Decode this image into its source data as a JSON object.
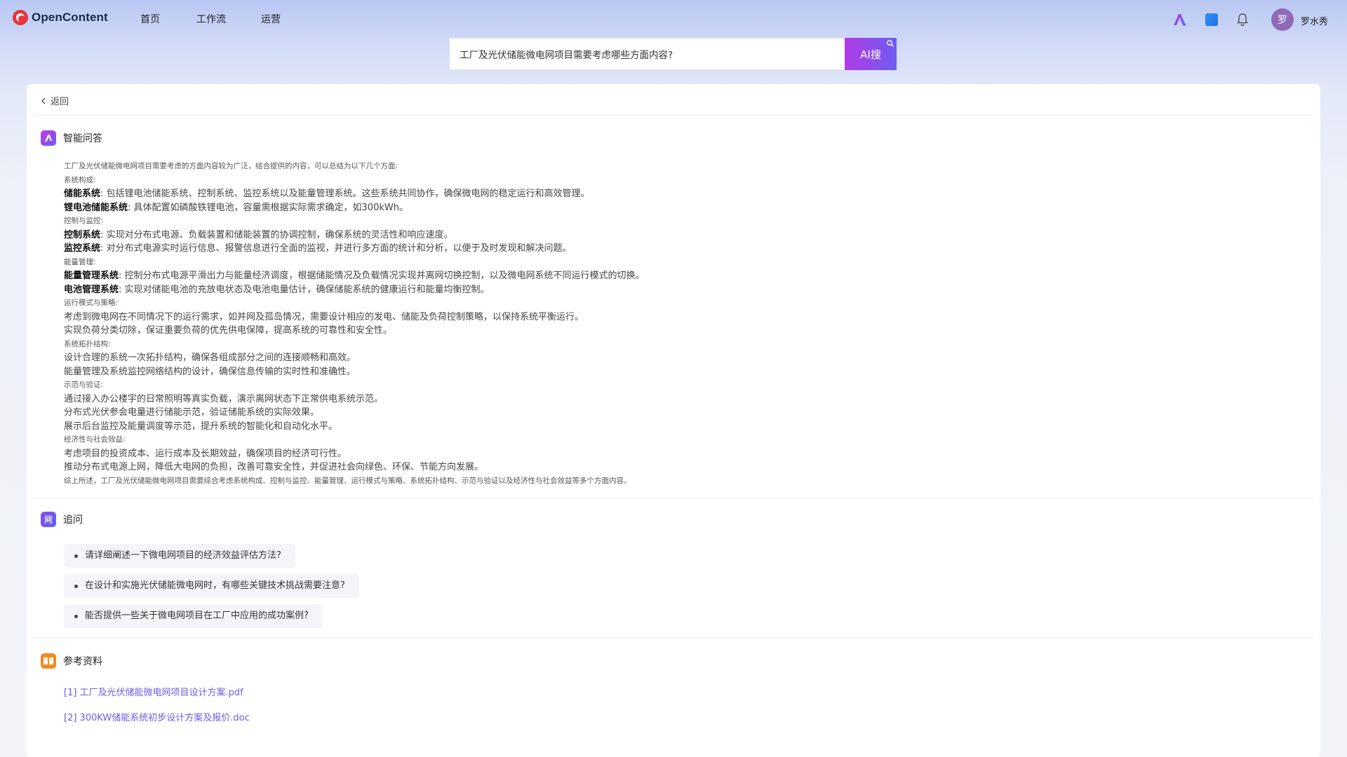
{
  "brand": {
    "name": "OpenContent"
  },
  "nav": {
    "items": [
      "首页",
      "工作流",
      "运营"
    ]
  },
  "user": {
    "avatar_initial": "罗",
    "name": "罗水秀"
  },
  "search": {
    "value": "工厂及光伏储能微电网项目需要考虑哪些方面内容?",
    "button_label": "AI搜"
  },
  "back_label": "返回",
  "answer": {
    "title": "智能问答",
    "lines": [
      {
        "style": "small",
        "text": "工厂及光伏储能微电网项目需要考虑的方面内容较为广泛，结合提供的内容，可以总结为以下几个方面:"
      },
      {
        "style": "small",
        "text": "系统构成:"
      },
      {
        "style": "body",
        "label": "储能系统",
        "text": ": 包括锂电池储能系统、控制系统、监控系统以及能量管理系统。这些系统共同协作，确保微电网的稳定运行和高效管理。"
      },
      {
        "style": "body",
        "label": "锂电池储能系统",
        "text": ": 具体配置如磷酸铁锂电池，容量需根据实际需求确定，如300kWh。"
      },
      {
        "style": "small",
        "text": "控制与监控:"
      },
      {
        "style": "body",
        "label": "控制系统",
        "text": ": 实现对分布式电源、负载装置和储能装置的协调控制，确保系统的灵活性和响应速度。"
      },
      {
        "style": "body",
        "label": "监控系统",
        "text": ": 对分布式电源实时运行信息、报警信息进行全面的监视，并进行多方面的统计和分析，以便于及时发现和解决问题。"
      },
      {
        "style": "small",
        "text": "能量管理:"
      },
      {
        "style": "body",
        "label": "能量管理系统",
        "text": ": 控制分布式电源平滑出力与能量经济调度，根据储能情况及负载情况实现并离网切换控制，以及微电网系统不同运行模式的切换。"
      },
      {
        "style": "body",
        "label": "电池管理系统",
        "text": ": 实现对储能电池的充放电状态及电池电量估计，确保储能系统的健康运行和能量均衡控制。"
      },
      {
        "style": "small",
        "text": "运行模式与策略:"
      },
      {
        "style": "body",
        "label": "",
        "text": "考虑到微电网在不同情况下的运行需求，如并网及孤岛情况，需要设计相应的发电、储能及负荷控制策略，以保持系统平衡运行。"
      },
      {
        "style": "body",
        "label": "",
        "text": "实现负荷分类切除，保证重要负荷的优先供电保障，提高系统的可靠性和安全性。"
      },
      {
        "style": "small",
        "text": "系统拓扑结构:"
      },
      {
        "style": "body",
        "label": "",
        "text": "设计合理的系统一次拓扑结构，确保各组成部分之间的连接顺畅和高效。"
      },
      {
        "style": "body",
        "label": "",
        "text": "能量管理及系统监控网络结构的设计，确保信息传输的实时性和准确性。"
      },
      {
        "style": "small",
        "text": "示范与验证:"
      },
      {
        "style": "body",
        "label": "",
        "text": "通过接入办公楼宇的日常照明等真实负载，演示离网状态下正常供电系统示范。"
      },
      {
        "style": "body",
        "label": "",
        "text": "分布式光伏参会电量进行储能示范，验证储能系统的实际效果。"
      },
      {
        "style": "body",
        "label": "",
        "text": "展示后台监控及能量调度等示范，提升系统的智能化和自动化水平。"
      },
      {
        "style": "small",
        "text": "经济性与社会效益:"
      },
      {
        "style": "body",
        "label": "",
        "text": "考虑项目的投资成本、运行成本及长期效益，确保项目的经济可行性。"
      },
      {
        "style": "body",
        "label": "",
        "text": "推动分布式电源上网，降低大电网的负担，改善可靠安全性，并促进社会向绿色、环保、节能方向发展。"
      },
      {
        "style": "small",
        "text": "综上所述，工厂及光伏储能微电网项目需要综合考虑系统构成、控制与监控、能量管理、运行模式与策略、系统拓扑结构、示范与验证以及经济性与社会效益等多个方面内容。"
      }
    ]
  },
  "followup": {
    "title": "追问",
    "items": [
      "请详细阐述一下微电网项目的经济效益评估方法?",
      "在设计和实施光伏储能微电网时，有哪些关键技术挑战需要注意?",
      "能否提供一些关于微电网项目在工厂中应用的成功案例?"
    ]
  },
  "references": {
    "title": "参考资料",
    "items": [
      "[1] 工厂及光伏储能微电网项目设计方案.pdf",
      "[2] 300KW储能系统初步设计方案及报价.doc"
    ]
  },
  "colors": {
    "accent": "#8b4cf0",
    "link": "#6a5ce6",
    "ref_icon": "#f08a24"
  }
}
